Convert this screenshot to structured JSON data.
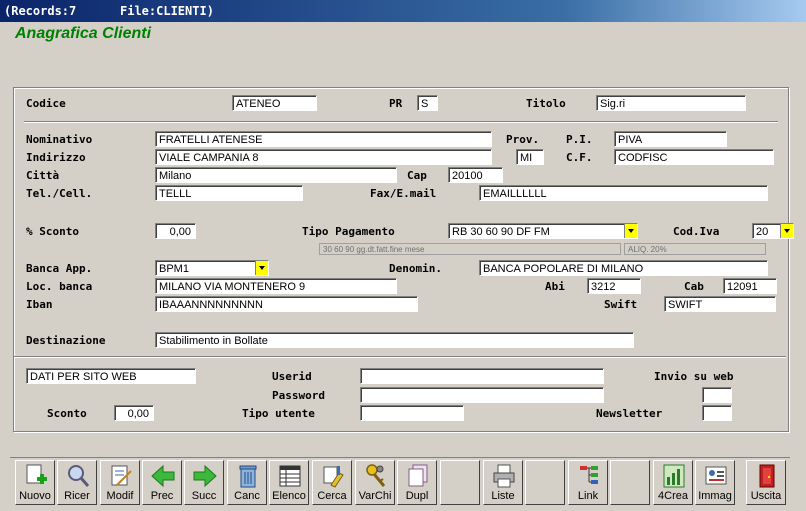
{
  "titlebar": {
    "records": "(Records:7",
    "file": "File:CLIENTI)"
  },
  "app_title": "Anagrafica Clienti",
  "form": {
    "codice": {
      "label": "Codice",
      "value": "ATENEO"
    },
    "pr": {
      "label": "PR",
      "value": "S"
    },
    "titolo": {
      "label": "Titolo",
      "value": "Sig.ri"
    },
    "nominativo": {
      "label": "Nominativo",
      "value": "FRATELLI ATENESE"
    },
    "prov": {
      "label": "Prov.",
      "value": "MI"
    },
    "pi": {
      "label": "P.I.",
      "value": "PIVA"
    },
    "indirizzo": {
      "label": "Indirizzo",
      "value": "VIALE CAMPANIA 8"
    },
    "cf": {
      "label": "C.F.",
      "value": "CODFISC"
    },
    "citta": {
      "label": "Città",
      "value": "Milano"
    },
    "cap": {
      "label": "Cap",
      "value": "20100"
    },
    "tel": {
      "label": "Tel./Cell.",
      "value": "TELLL"
    },
    "fax": {
      "label": "Fax/E.mail",
      "value": "EMAILLLLLL"
    },
    "sconto": {
      "label": "% Sconto",
      "value": "0,00"
    },
    "tipo_pagamento": {
      "label": "Tipo Pagamento",
      "value": "RB 30 60 90 DF FM",
      "hint": "30 60 90 gg.dt.fatt.fine mese"
    },
    "cod_iva": {
      "label": "Cod.Iva",
      "value": "20",
      "hint": "ALIQ. 20%"
    },
    "banca_app": {
      "label": "Banca App.",
      "value": "BPM1"
    },
    "denomin": {
      "label": "Denomin.",
      "value": "BANCA POPOLARE DI MILANO"
    },
    "loc_banca": {
      "label": "Loc. banca",
      "value": "MILANO VIA MONTENERO 9"
    },
    "abi": {
      "label": "Abi",
      "value": "3212"
    },
    "cab": {
      "label": "Cab",
      "value": "12091"
    },
    "iban": {
      "label": "Iban",
      "value": "IBAAANNNNNNNNN"
    },
    "swift": {
      "label": "Swift",
      "value": "SWIFT"
    },
    "destinazione": {
      "label": "Destinazione",
      "value": "Stabilimento in Bollate"
    }
  },
  "web": {
    "dati_sito": "DATI PER SITO WEB",
    "userid": {
      "label": "Userid",
      "value": ""
    },
    "password": {
      "label": "Password",
      "value": ""
    },
    "tipo_utente": {
      "label": "Tipo utente",
      "value": ""
    },
    "sconto": {
      "label": "Sconto",
      "value": "0,00"
    },
    "invio": {
      "label": "Invio su web",
      "value": ""
    },
    "newsletter": {
      "label": "Newsletter",
      "value": ""
    }
  },
  "toolbar": [
    {
      "id": "nuovo",
      "label": "Nuovo",
      "icon": "new-document-icon"
    },
    {
      "id": "ricer",
      "label": "Ricer",
      "icon": "magnifier-icon"
    },
    {
      "id": "modif",
      "label": "Modif",
      "icon": "edit-document-icon"
    },
    {
      "id": "prec",
      "label": "Prec",
      "icon": "arrow-left-icon"
    },
    {
      "id": "succ",
      "label": "Succ",
      "icon": "arrow-right-icon"
    },
    {
      "id": "canc",
      "label": "Canc",
      "icon": "trash-icon"
    },
    {
      "id": "elenco",
      "label": "Elenco",
      "icon": "list-table-icon"
    },
    {
      "id": "cerca",
      "label": "Cerca",
      "icon": "search-broom-icon"
    },
    {
      "id": "varchi",
      "label": "VarChi",
      "icon": "keys-icon"
    },
    {
      "id": "dupl",
      "label": "Dupl",
      "icon": "duplicate-icon"
    },
    {
      "id": "liste",
      "label": "Liste",
      "icon": "printer-icon"
    },
    {
      "id": "link",
      "label": "Link",
      "icon": "link-tree-icon"
    },
    {
      "id": "4crea",
      "label": "4Crea",
      "icon": "create-chart-icon"
    },
    {
      "id": "immag",
      "label": "Immag",
      "icon": "image-card-icon"
    },
    {
      "id": "uscita",
      "label": "Uscita",
      "icon": "exit-door-icon"
    }
  ],
  "colors": {
    "accent": "#008000",
    "dropdown": "#ffff00",
    "titlebar": "#0a246a"
  }
}
